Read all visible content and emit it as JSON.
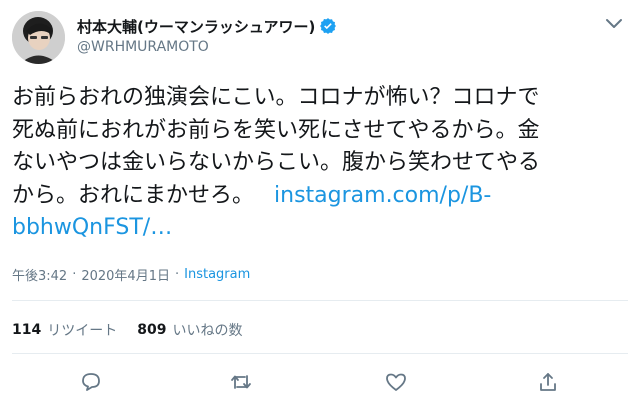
{
  "user": {
    "display_name": "村本大輔(ウーマンラッシュアワー)",
    "handle": "@WRHMURAMOTO",
    "verified": true
  },
  "tweet": {
    "lines": [
      "お前らおれの独演会にこい。コロナが怖い？コロナで",
      "死ぬ前におれがお前らを笑い死にさせてやるから。金",
      "ないやつは金いらないからこい。腹から笑わせてやる",
      "から。おれにまかせろ。"
    ],
    "link_part1": "instagram.com/p/B-",
    "link_part2": "bbhwQnFST/…"
  },
  "meta": {
    "time": "午後3:42",
    "separator1": "·",
    "date": "2020年4月1日",
    "separator2": "·",
    "source": "Instagram"
  },
  "stats": {
    "retweet_count": "114",
    "retweet_label": "リツイート",
    "like_count": "809",
    "like_label": "いいねの数"
  },
  "icons": {
    "verified": "verified-badge-icon",
    "more": "chevron-down-icon",
    "reply": "reply-icon",
    "retweet": "retweet-icon",
    "like": "heart-icon",
    "share": "share-icon"
  },
  "colors": {
    "link": "#1b95e0",
    "muted": "#657786",
    "text": "#14171a",
    "divider": "#e6ecf0",
    "verified": "#1da1f2"
  }
}
